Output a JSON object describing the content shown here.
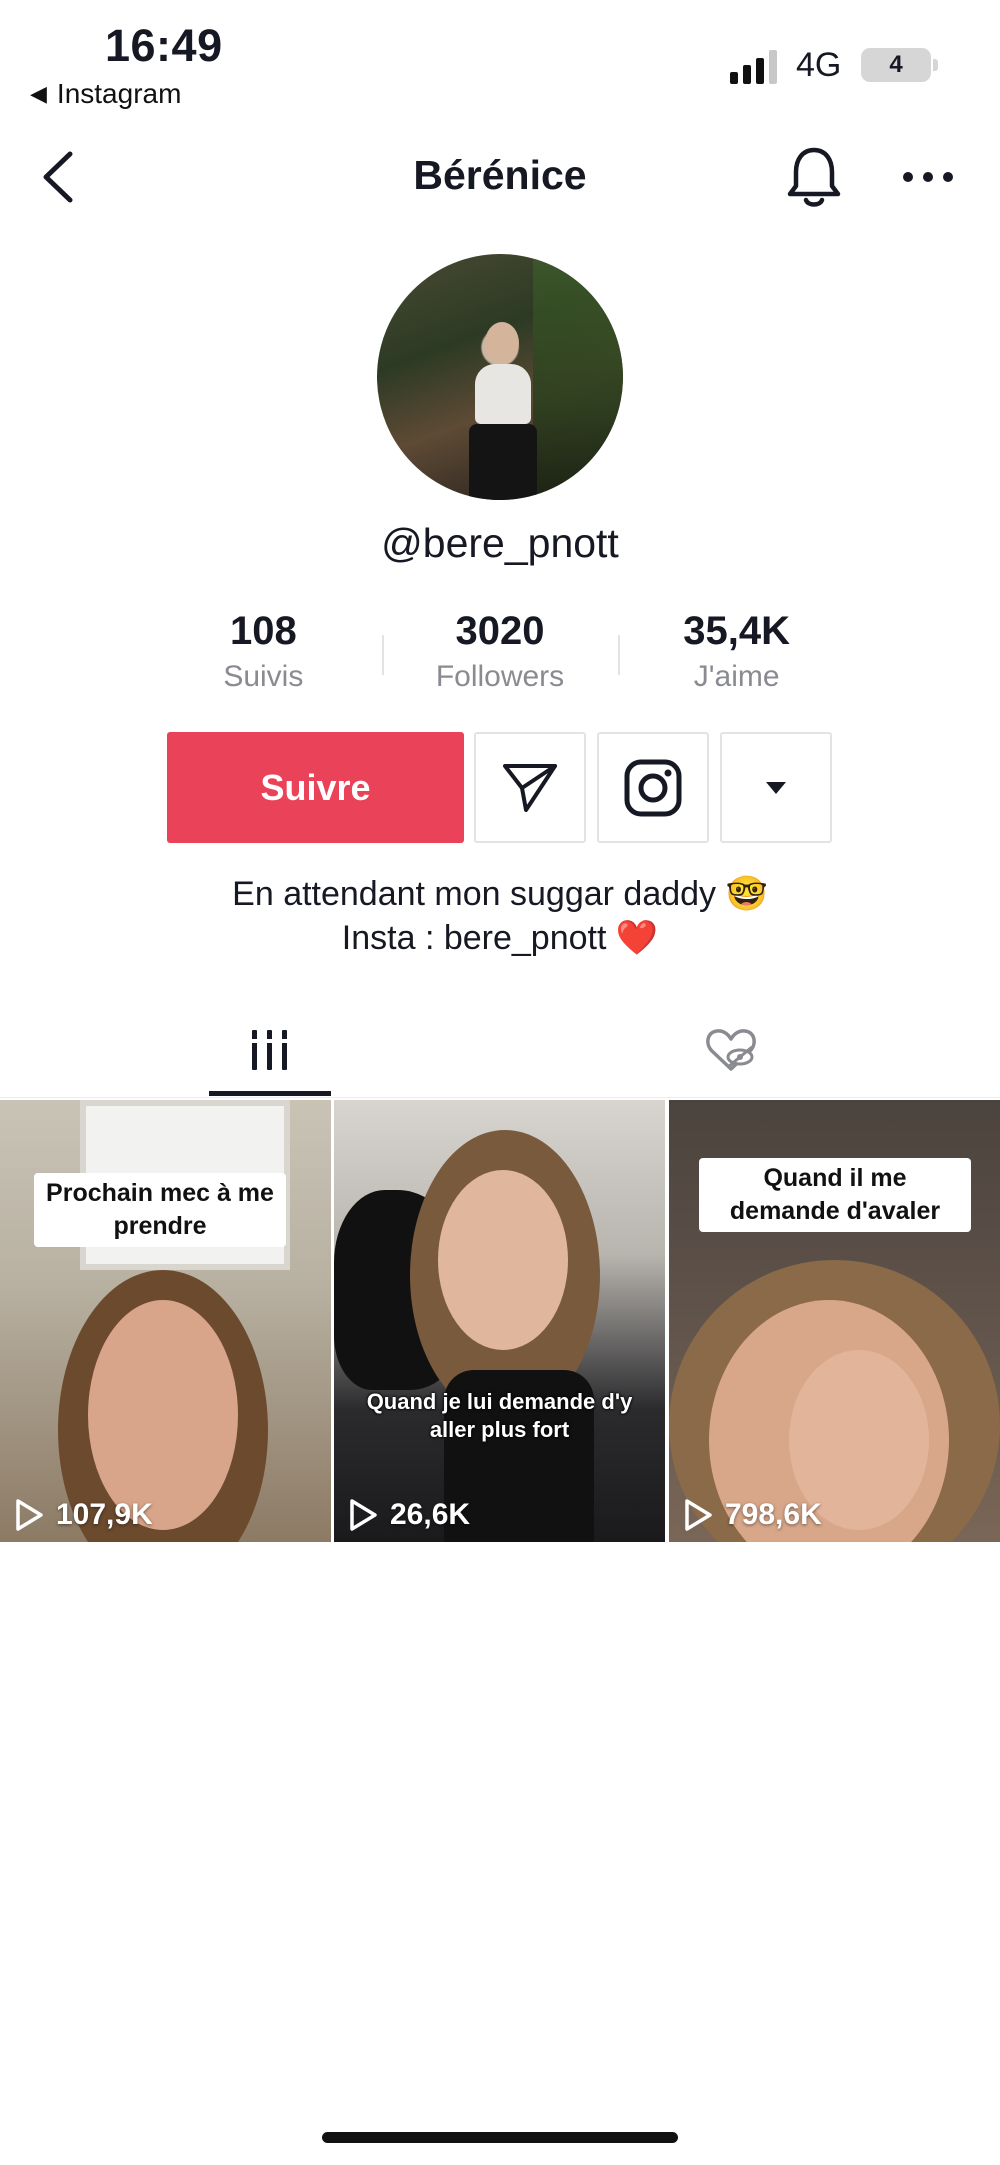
{
  "status_bar": {
    "time": "16:49",
    "back_app": "Instagram",
    "network": "4G",
    "battery": "4"
  },
  "nav": {
    "title": "Bérénice"
  },
  "profile": {
    "username": "@bere_pnott",
    "stats": [
      {
        "value": "108",
        "label": "Suivis"
      },
      {
        "value": "3020",
        "label": "Followers"
      },
      {
        "value": "35,4K",
        "label": "J'aime"
      }
    ],
    "follow_label": "Suivre",
    "bio_line1": "En attendant mon suggar daddy 🤓",
    "bio_line2": "Insta : bere_pnott ❤️"
  },
  "videos": [
    {
      "caption": "Prochain mec à me prendre",
      "views": "107,9K"
    },
    {
      "caption": "Quand je lui demande d'y aller plus fort",
      "views": "26,6K"
    },
    {
      "caption": "Quand il me demande d'avaler",
      "views": "798,6K"
    }
  ],
  "colors": {
    "accent": "#ea4359",
    "text": "#161823",
    "muted": "#8a8b91"
  }
}
